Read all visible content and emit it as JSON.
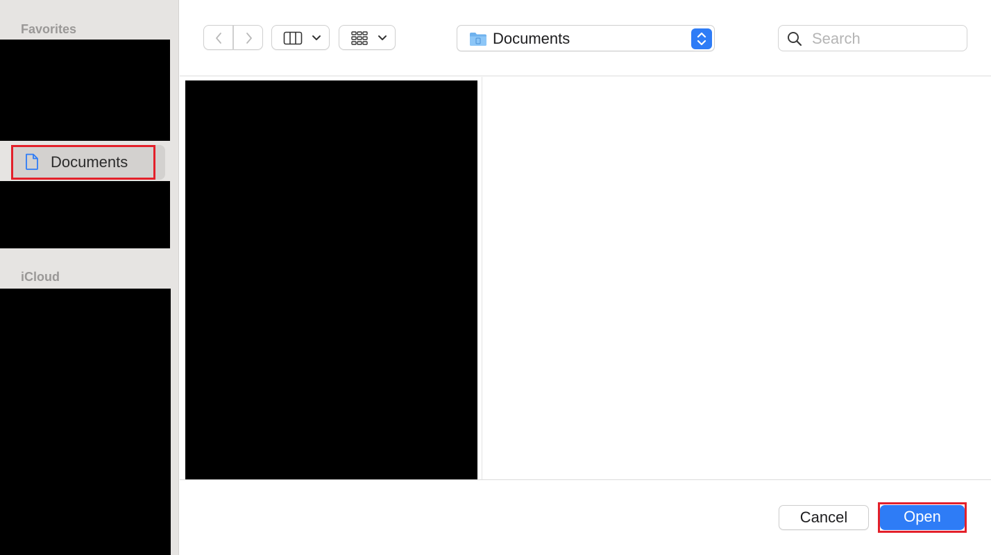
{
  "sidebar": {
    "favorites_header": "Favorites",
    "icloud_header": "iCloud",
    "selected_item": {
      "label": "Documents",
      "icon": "document-icon"
    }
  },
  "toolbar": {
    "back_icon": "chevron-left-icon",
    "forward_icon": "chevron-right-icon",
    "view_mode_icon": "column-view-icon",
    "group_icon": "icon-grid-icon",
    "location": {
      "label": "Documents",
      "icon": "folder-icon"
    },
    "search": {
      "placeholder": "Search",
      "value": ""
    }
  },
  "footer": {
    "cancel_label": "Cancel",
    "open_label": "Open"
  },
  "colors": {
    "accent": "#2e7cf6",
    "highlight": "#e3202a",
    "sidebar_bg": "#e6e4e2"
  }
}
